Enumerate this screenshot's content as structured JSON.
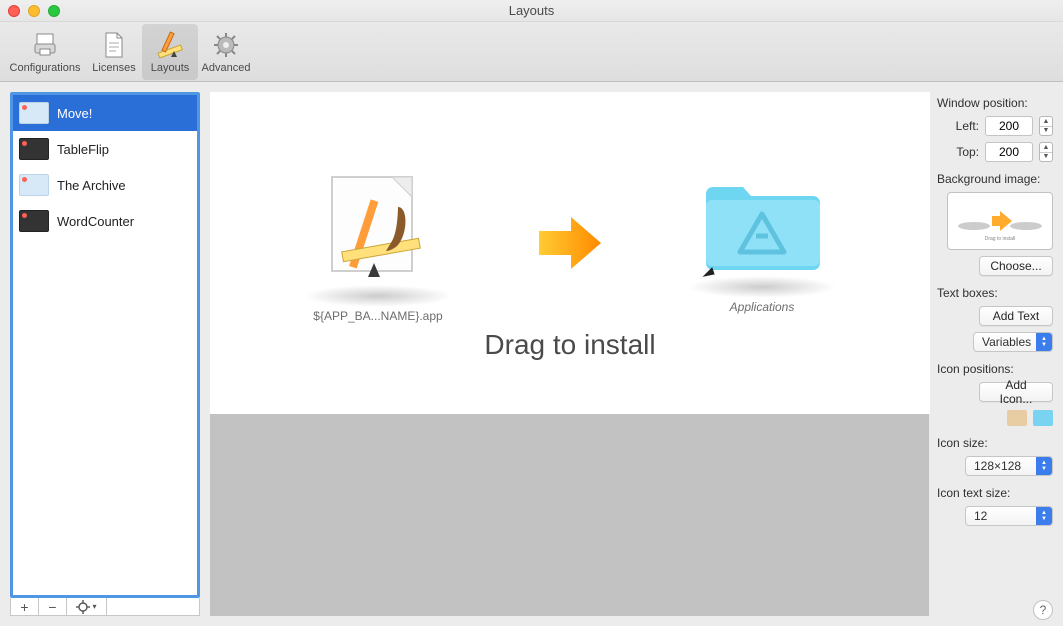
{
  "window": {
    "title": "Layouts"
  },
  "toolbar": {
    "items": [
      {
        "label": "Configurations"
      },
      {
        "label": "Licenses"
      },
      {
        "label": "Layouts"
      },
      {
        "label": "Advanced"
      }
    ]
  },
  "sidebar": {
    "items": [
      {
        "label": "Move!"
      },
      {
        "label": "TableFlip"
      },
      {
        "label": "The Archive"
      },
      {
        "label": "WordCounter"
      }
    ],
    "selected_index": 0
  },
  "canvas": {
    "app_label": "${APP_BA...NAME}.app",
    "applications_label": "Applications",
    "drag_text": "Drag to install"
  },
  "inspector": {
    "window_position_label": "Window position:",
    "left_label": "Left:",
    "left_value": "200",
    "top_label": "Top:",
    "top_value": "200",
    "background_image_label": "Background image:",
    "choose_button": "Choose...",
    "text_boxes_label": "Text boxes:",
    "add_text_button": "Add Text",
    "variables_popup": "Variables",
    "icon_positions_label": "Icon positions:",
    "add_icon_button": "Add Icon...",
    "icon_size_label": "Icon size:",
    "icon_size_value": "128×128",
    "icon_text_size_label": "Icon text size:",
    "icon_text_size_value": "12"
  }
}
